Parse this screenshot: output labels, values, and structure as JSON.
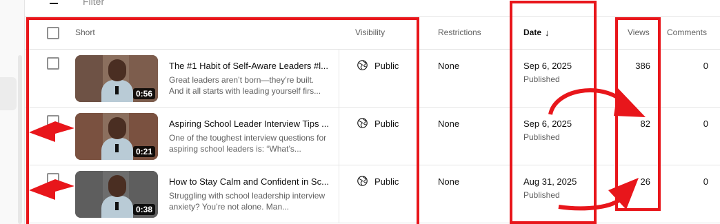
{
  "filter": {
    "placeholder": "Filter"
  },
  "table": {
    "columns": {
      "short": "Short",
      "visibility": "Visibility",
      "restrictions": "Restrictions",
      "date": "Date",
      "views": "Views",
      "comments": "Comments"
    },
    "sorted_column": "Date",
    "sort_direction": "descending",
    "rows": [
      {
        "title": "The #1 Habit of Self-Aware Leaders #l...",
        "description": "Great leaders aren’t born—they’re built. And it all starts with leading yourself firs...",
        "duration": "0:56",
        "visibility": "Public",
        "restrictions": "None",
        "date": "Sep 6, 2025",
        "status": "Published",
        "views": "386",
        "comments": "0"
      },
      {
        "title": "Aspiring School Leader Interview Tips ...",
        "description": "One of the toughest interview questions for aspiring school leaders is: “What’s...",
        "duration": "0:21",
        "visibility": "Public",
        "restrictions": "None",
        "date": "Sep 6, 2025",
        "status": "Published",
        "views": "82",
        "comments": "0"
      },
      {
        "title": "How to Stay Calm and Confident in Sc...",
        "description": "Struggling with school leadership interview anxiety? You’re not alone. Man...",
        "duration": "0:38",
        "visibility": "Public",
        "restrictions": "None",
        "date": "Aug 31, 2025",
        "status": "Published",
        "views": "26",
        "comments": "0"
      }
    ]
  },
  "annotations": {
    "color": "#e8161b",
    "icons": [
      "highlight-box",
      "arrow"
    ]
  },
  "colors": {
    "text_primary": "#0f0f0f",
    "text_secondary": "#606060",
    "divider": "#e5e5e5"
  }
}
